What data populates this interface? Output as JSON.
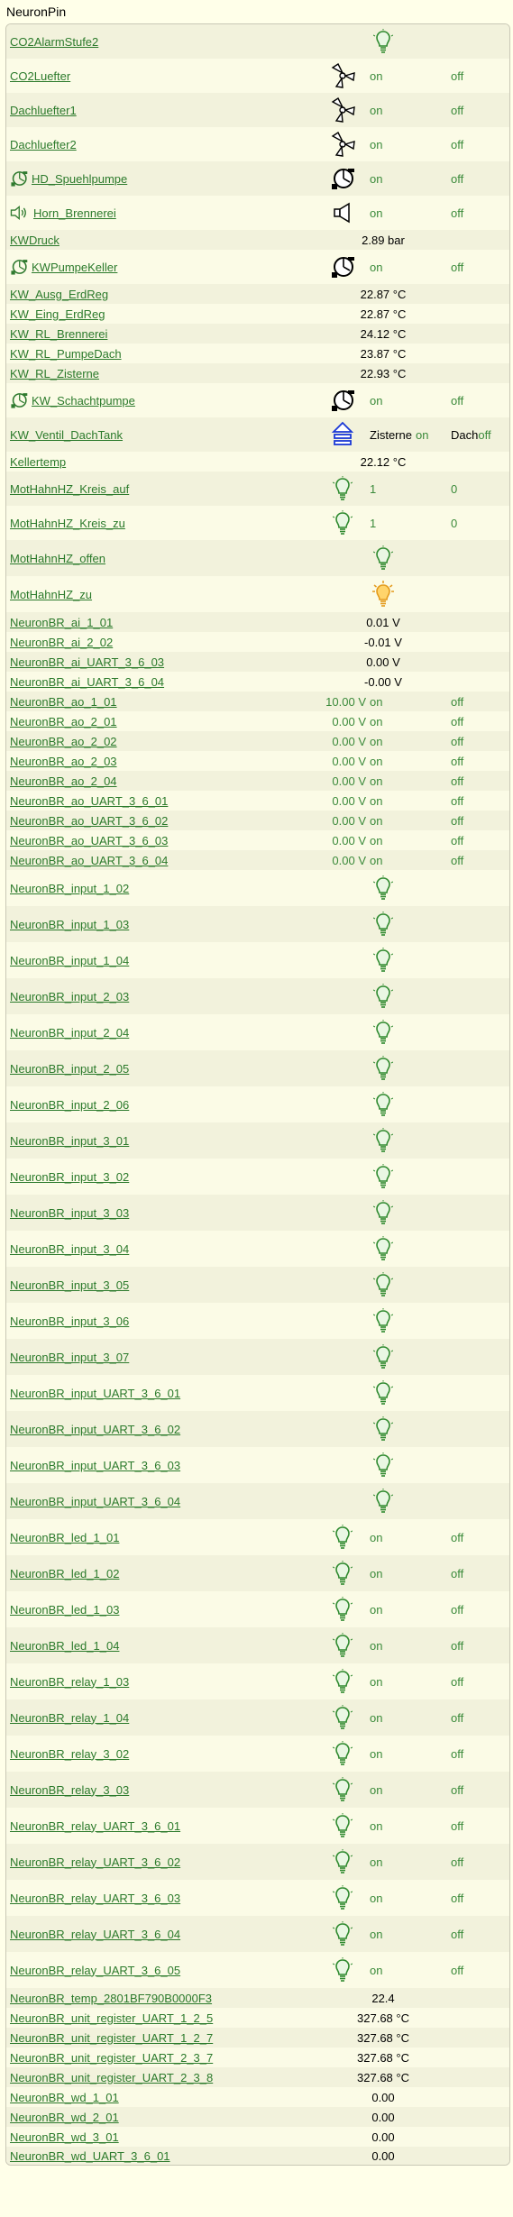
{
  "title": "NeuronPin",
  "rows": [
    {
      "name": "CO2AlarmStufe2",
      "type": "state",
      "icon": "bulb-green-icon",
      "h": 38
    },
    {
      "name": "CO2Luefter",
      "type": "onoff",
      "icon": "fan-icon",
      "on": "on",
      "off": "off",
      "h": 38
    },
    {
      "name": "Dachluefter1",
      "type": "onoff",
      "icon": "fan-icon",
      "on": "on",
      "off": "off",
      "h": 38
    },
    {
      "name": "Dachluefter2",
      "type": "onoff",
      "icon": "fan-icon",
      "on": "on",
      "off": "off",
      "h": 38
    },
    {
      "name": "HD_Spuehlpumpe",
      "type": "onoff",
      "icon": "pump-icon",
      "prefix": "pump-icon",
      "on": "on",
      "off": "off",
      "h": 38
    },
    {
      "name": "Horn_Brennerei",
      "type": "onoff",
      "icon": "horn-icon",
      "prefix": "horn-icon",
      "on": "on",
      "off": "off",
      "h": 38
    },
    {
      "name": "KWDruck",
      "type": "value",
      "value": "2.89 bar",
      "h": 22
    },
    {
      "name": "KWPumpeKeller",
      "type": "onoff",
      "icon": "pump-icon",
      "prefix": "pump-icon",
      "on": "on",
      "off": "off",
      "h": 38
    },
    {
      "name": "KW_Ausg_ErdReg",
      "type": "value",
      "value": "22.87 °C",
      "h": 22
    },
    {
      "name": "KW_Eing_ErdReg",
      "type": "value",
      "value": "22.87 °C",
      "h": 22
    },
    {
      "name": "KW_RL_Brennerei",
      "type": "value",
      "value": "24.12 °C",
      "h": 22
    },
    {
      "name": "KW_RL_PumpeDach",
      "type": "value",
      "value": "23.87 °C",
      "h": 22
    },
    {
      "name": "KW_RL_Zisterne",
      "type": "value",
      "value": "22.93 °C",
      "h": 22
    },
    {
      "name": "KW_Schachtpumpe",
      "type": "onoff",
      "icon": "pump-icon",
      "prefix": "pump-icon",
      "on": "on",
      "off": "off",
      "h": 38
    },
    {
      "name": "KW_Ventil_DachTank",
      "type": "twoway",
      "icon": "valve-icon",
      "a_label": "Zisterne",
      "a_state": "on",
      "b_label": "Dach",
      "b_state": "off",
      "h": 38
    },
    {
      "name": "Kellertemp",
      "type": "value",
      "value": "22.12 °C",
      "h": 22
    },
    {
      "name": "MotHahnHZ_Kreis_auf",
      "type": "onoff",
      "icon": "bulb-green-icon",
      "on": "1",
      "off": "0",
      "h": 38
    },
    {
      "name": "MotHahnHZ_Kreis_zu",
      "type": "onoff",
      "icon": "bulb-green-icon",
      "on": "1",
      "off": "0",
      "h": 38
    },
    {
      "name": "MotHahnHZ_offen",
      "type": "state",
      "icon": "bulb-green-icon",
      "h": 40
    },
    {
      "name": "MotHahnHZ_zu",
      "type": "state",
      "icon": "bulb-on-icon",
      "h": 40
    },
    {
      "name": "NeuronBR_ai_1_01",
      "type": "value",
      "value": "0.01 V",
      "h": 22
    },
    {
      "name": "NeuronBR_ai_2_02",
      "type": "value",
      "value": "-0.01 V",
      "h": 22
    },
    {
      "name": "NeuronBR_ai_UART_3_6_03",
      "type": "value",
      "value": "0.00 V",
      "h": 22
    },
    {
      "name": "NeuronBR_ai_UART_3_6_04",
      "type": "value",
      "value": "-0.00 V",
      "h": 22
    },
    {
      "name": "NeuronBR_ao_1_01",
      "type": "aout",
      "value": "10.00 V",
      "on": "on",
      "off": "off",
      "h": 22
    },
    {
      "name": "NeuronBR_ao_2_01",
      "type": "aout",
      "value": "0.00 V",
      "on": "on",
      "off": "off",
      "h": 22
    },
    {
      "name": "NeuronBR_ao_2_02",
      "type": "aout",
      "value": "0.00 V",
      "on": "on",
      "off": "off",
      "h": 22
    },
    {
      "name": "NeuronBR_ao_2_03",
      "type": "aout",
      "value": "0.00 V",
      "on": "on",
      "off": "off",
      "h": 22
    },
    {
      "name": "NeuronBR_ao_2_04",
      "type": "aout",
      "value": "0.00 V",
      "on": "on",
      "off": "off",
      "h": 22
    },
    {
      "name": "NeuronBR_ao_UART_3_6_01",
      "type": "aout",
      "value": "0.00 V",
      "on": "on",
      "off": "off",
      "h": 22
    },
    {
      "name": "NeuronBR_ao_UART_3_6_02",
      "type": "aout",
      "value": "0.00 V",
      "on": "on",
      "off": "off",
      "h": 22
    },
    {
      "name": "NeuronBR_ao_UART_3_6_03",
      "type": "aout",
      "value": "0.00 V",
      "on": "on",
      "off": "off",
      "h": 22
    },
    {
      "name": "NeuronBR_ao_UART_3_6_04",
      "type": "aout",
      "value": "0.00 V",
      "on": "on",
      "off": "off",
      "h": 22
    },
    {
      "name": "NeuronBR_input_1_02",
      "type": "state",
      "icon": "bulb-green-icon",
      "h": 40
    },
    {
      "name": "NeuronBR_input_1_03",
      "type": "state",
      "icon": "bulb-green-icon",
      "h": 40
    },
    {
      "name": "NeuronBR_input_1_04",
      "type": "state",
      "icon": "bulb-green-icon",
      "h": 40
    },
    {
      "name": "NeuronBR_input_2_03",
      "type": "state",
      "icon": "bulb-green-icon",
      "h": 40
    },
    {
      "name": "NeuronBR_input_2_04",
      "type": "state",
      "icon": "bulb-green-icon",
      "h": 40
    },
    {
      "name": "NeuronBR_input_2_05",
      "type": "state",
      "icon": "bulb-green-icon",
      "h": 40
    },
    {
      "name": "NeuronBR_input_2_06",
      "type": "state",
      "icon": "bulb-green-icon",
      "h": 40
    },
    {
      "name": "NeuronBR_input_3_01",
      "type": "state",
      "icon": "bulb-green-icon",
      "h": 40
    },
    {
      "name": "NeuronBR_input_3_02",
      "type": "state",
      "icon": "bulb-green-icon",
      "h": 40
    },
    {
      "name": "NeuronBR_input_3_03",
      "type": "state",
      "icon": "bulb-green-icon",
      "h": 40
    },
    {
      "name": "NeuronBR_input_3_04",
      "type": "state",
      "icon": "bulb-green-icon",
      "h": 40
    },
    {
      "name": "NeuronBR_input_3_05",
      "type": "state",
      "icon": "bulb-green-icon",
      "h": 40
    },
    {
      "name": "NeuronBR_input_3_06",
      "type": "state",
      "icon": "bulb-green-icon",
      "h": 40
    },
    {
      "name": "NeuronBR_input_3_07",
      "type": "state",
      "icon": "bulb-green-icon",
      "h": 40
    },
    {
      "name": "NeuronBR_input_UART_3_6_01",
      "type": "state",
      "icon": "bulb-green-icon",
      "h": 40
    },
    {
      "name": "NeuronBR_input_UART_3_6_02",
      "type": "state",
      "icon": "bulb-green-icon",
      "h": 40
    },
    {
      "name": "NeuronBR_input_UART_3_6_03",
      "type": "state",
      "icon": "bulb-green-icon",
      "h": 40
    },
    {
      "name": "NeuronBR_input_UART_3_6_04",
      "type": "state",
      "icon": "bulb-green-icon",
      "h": 40
    },
    {
      "name": "NeuronBR_led_1_01",
      "type": "onoff",
      "icon": "bulb-green-icon",
      "on": "on",
      "off": "off",
      "h": 40
    },
    {
      "name": "NeuronBR_led_1_02",
      "type": "onoff",
      "icon": "bulb-green-icon",
      "on": "on",
      "off": "off",
      "h": 40
    },
    {
      "name": "NeuronBR_led_1_03",
      "type": "onoff",
      "icon": "bulb-green-icon",
      "on": "on",
      "off": "off",
      "h": 40
    },
    {
      "name": "NeuronBR_led_1_04",
      "type": "onoff",
      "icon": "bulb-green-icon",
      "on": "on",
      "off": "off",
      "h": 40
    },
    {
      "name": "NeuronBR_relay_1_03",
      "type": "onoff",
      "icon": "bulb-green-icon",
      "on": "on",
      "off": "off",
      "h": 40
    },
    {
      "name": "NeuronBR_relay_1_04",
      "type": "onoff",
      "icon": "bulb-green-icon",
      "on": "on",
      "off": "off",
      "h": 40
    },
    {
      "name": "NeuronBR_relay_3_02",
      "type": "onoff",
      "icon": "bulb-green-icon",
      "on": "on",
      "off": "off",
      "h": 40
    },
    {
      "name": "NeuronBR_relay_3_03",
      "type": "onoff",
      "icon": "bulb-green-icon",
      "on": "on",
      "off": "off",
      "h": 40
    },
    {
      "name": "NeuronBR_relay_UART_3_6_01",
      "type": "onoff",
      "icon": "bulb-green-icon",
      "on": "on",
      "off": "off",
      "h": 40
    },
    {
      "name": "NeuronBR_relay_UART_3_6_02",
      "type": "onoff",
      "icon": "bulb-green-icon",
      "on": "on",
      "off": "off",
      "h": 40
    },
    {
      "name": "NeuronBR_relay_UART_3_6_03",
      "type": "onoff",
      "icon": "bulb-green-icon",
      "on": "on",
      "off": "off",
      "h": 40
    },
    {
      "name": "NeuronBR_relay_UART_3_6_04",
      "type": "onoff",
      "icon": "bulb-green-icon",
      "on": "on",
      "off": "off",
      "h": 40
    },
    {
      "name": "NeuronBR_relay_UART_3_6_05",
      "type": "onoff",
      "icon": "bulb-green-icon",
      "on": "on",
      "off": "off",
      "h": 40
    },
    {
      "name": "NeuronBR_temp_2801BF790B0000F3",
      "type": "value",
      "value": "22.4",
      "h": 22
    },
    {
      "name": "NeuronBR_unit_register_UART_1_2_5",
      "type": "value",
      "value": "327.68 °C",
      "h": 22
    },
    {
      "name": "NeuronBR_unit_register_UART_1_2_7",
      "type": "value",
      "value": "327.68 °C",
      "h": 22
    },
    {
      "name": "NeuronBR_unit_register_UART_2_3_7",
      "type": "value",
      "value": "327.68 °C",
      "h": 22
    },
    {
      "name": "NeuronBR_unit_register_UART_2_3_8",
      "type": "value",
      "value": "327.68 °C",
      "h": 22
    },
    {
      "name": "NeuronBR_wd_1_01",
      "type": "value",
      "value": "0.00",
      "h": 22
    },
    {
      "name": "NeuronBR_wd_2_01",
      "type": "value",
      "value": "0.00",
      "h": 22
    },
    {
      "name": "NeuronBR_wd_3_01",
      "type": "value",
      "value": "0.00",
      "h": 22
    },
    {
      "name": "NeuronBR_wd_UART_3_6_01",
      "type": "value",
      "value": "0.00",
      "h": 20
    }
  ]
}
